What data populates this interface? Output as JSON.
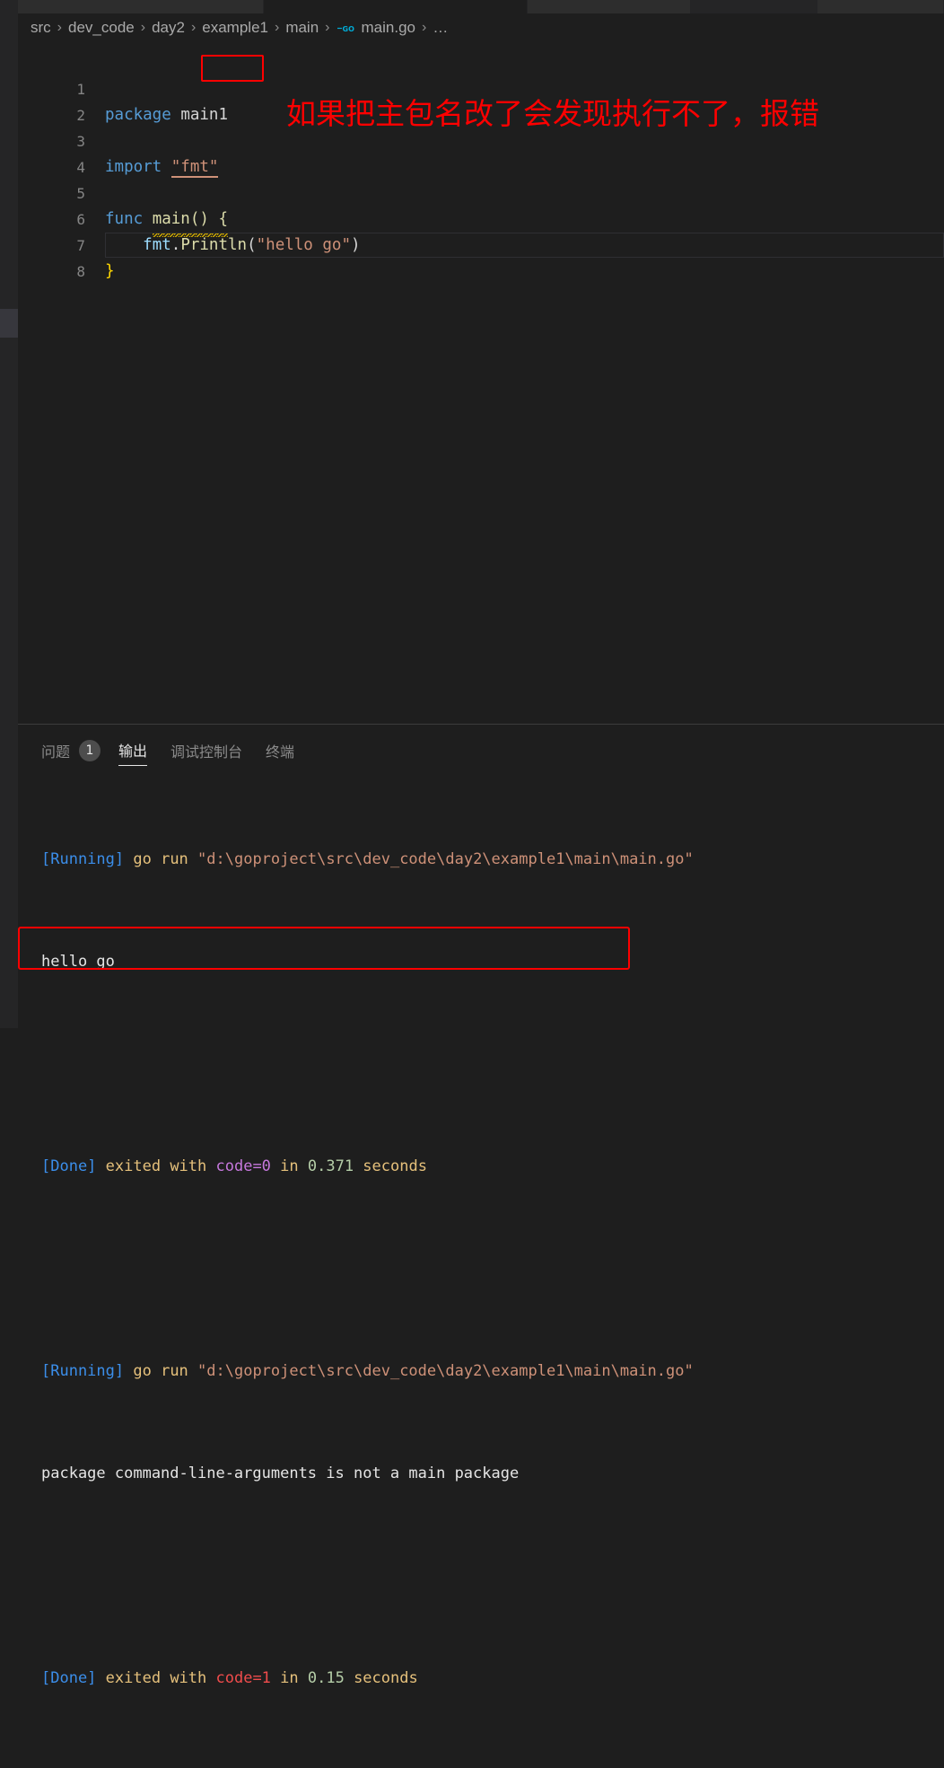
{
  "window": {
    "tabs_visible_count": 5
  },
  "breadcrumb": {
    "items": [
      "src",
      "dev_code",
      "day2",
      "example1",
      "main",
      "main.go",
      "…"
    ],
    "separator": "›",
    "file_icon": "go-lang-icon"
  },
  "editor": {
    "language": "go",
    "lines": [
      {
        "num": "1",
        "segments": [
          {
            "t": "package",
            "c": "kw"
          },
          {
            "t": " ",
            "c": "pln"
          },
          {
            "t": "main1",
            "c": "pln"
          }
        ]
      },
      {
        "num": "2",
        "segments": []
      },
      {
        "num": "3",
        "segments": [
          {
            "t": "import",
            "c": "kw"
          },
          {
            "t": " ",
            "c": "pln"
          },
          {
            "t": "\"fmt\"",
            "c": "str-uline"
          }
        ]
      },
      {
        "num": "4",
        "segments": []
      },
      {
        "num": "5",
        "segments": [
          {
            "t": "func",
            "c": "kw"
          },
          {
            "t": " ",
            "c": "pln"
          },
          {
            "t": "main() {",
            "c": "fn-squiggle"
          }
        ]
      },
      {
        "num": "6",
        "segments": [
          {
            "t": "    ",
            "c": "pln"
          },
          {
            "t": "fmt",
            "c": "pkg"
          },
          {
            "t": ".",
            "c": "punct"
          },
          {
            "t": "Println",
            "c": "fn"
          },
          {
            "t": "(",
            "c": "punct"
          },
          {
            "t": "\"hello go\"",
            "c": "str"
          },
          {
            "t": ")",
            "c": "punct"
          }
        ]
      },
      {
        "num": "7",
        "segments": [
          {
            "t": "}",
            "c": "brace"
          }
        ]
      },
      {
        "num": "8",
        "segments": []
      }
    ],
    "highlighted_token": "main1",
    "annotation_text": "如果把主包名改了会发现执行不了，报错",
    "annotation_color": "#ff0000",
    "highlight_box_color": "#ff0000"
  },
  "panel": {
    "tabs": [
      {
        "label": "问题",
        "active": false,
        "badge": "1"
      },
      {
        "label": "输出",
        "active": true,
        "badge": null
      },
      {
        "label": "调试控制台",
        "active": false,
        "badge": null
      },
      {
        "label": "终端",
        "active": false,
        "badge": null
      }
    ],
    "output_lines": [
      {
        "id": "run1",
        "parts": [
          {
            "t": "[Running]",
            "c": "c-running"
          },
          {
            "t": " ",
            "c": "c-plain"
          },
          {
            "t": "go run ",
            "c": "c-text"
          },
          {
            "t": "\"d:\\goproject\\src\\dev_code\\day2\\example1\\main\\main.go\"",
            "c": "c-path"
          }
        ]
      },
      {
        "id": "out1",
        "parts": [
          {
            "t": "hello go",
            "c": "c-white"
          }
        ]
      },
      {
        "id": "blank1",
        "parts": []
      },
      {
        "id": "done1",
        "parts": [
          {
            "t": "[Done]",
            "c": "c-done"
          },
          {
            "t": " ",
            "c": "c-plain"
          },
          {
            "t": "exited with ",
            "c": "c-text"
          },
          {
            "t": "code=0",
            "c": "c-code0"
          },
          {
            "t": " in ",
            "c": "c-text"
          },
          {
            "t": "0.371",
            "c": "c-num"
          },
          {
            "t": " seconds",
            "c": "c-text"
          }
        ]
      },
      {
        "id": "blank2",
        "parts": []
      },
      {
        "id": "run2",
        "parts": [
          {
            "t": "[Running]",
            "c": "c-running"
          },
          {
            "t": " ",
            "c": "c-plain"
          },
          {
            "t": "go run ",
            "c": "c-text"
          },
          {
            "t": "\"d:\\goproject\\src\\dev_code\\day2\\example1\\main\\main.go\"",
            "c": "c-path"
          }
        ]
      },
      {
        "id": "err1",
        "parts": [
          {
            "t": "package command-line-arguments is not a main package",
            "c": "c-white"
          }
        ]
      },
      {
        "id": "blank3",
        "parts": []
      },
      {
        "id": "done2",
        "parts": [
          {
            "t": "[Done]",
            "c": "c-done"
          },
          {
            "t": " ",
            "c": "c-plain"
          },
          {
            "t": "exited with ",
            "c": "c-text"
          },
          {
            "t": "code=1",
            "c": "c-code1"
          },
          {
            "t": " in ",
            "c": "c-text"
          },
          {
            "t": "0.15",
            "c": "c-num"
          },
          {
            "t": " seconds",
            "c": "c-text"
          }
        ]
      }
    ],
    "error_box_color": "#ff0000"
  }
}
